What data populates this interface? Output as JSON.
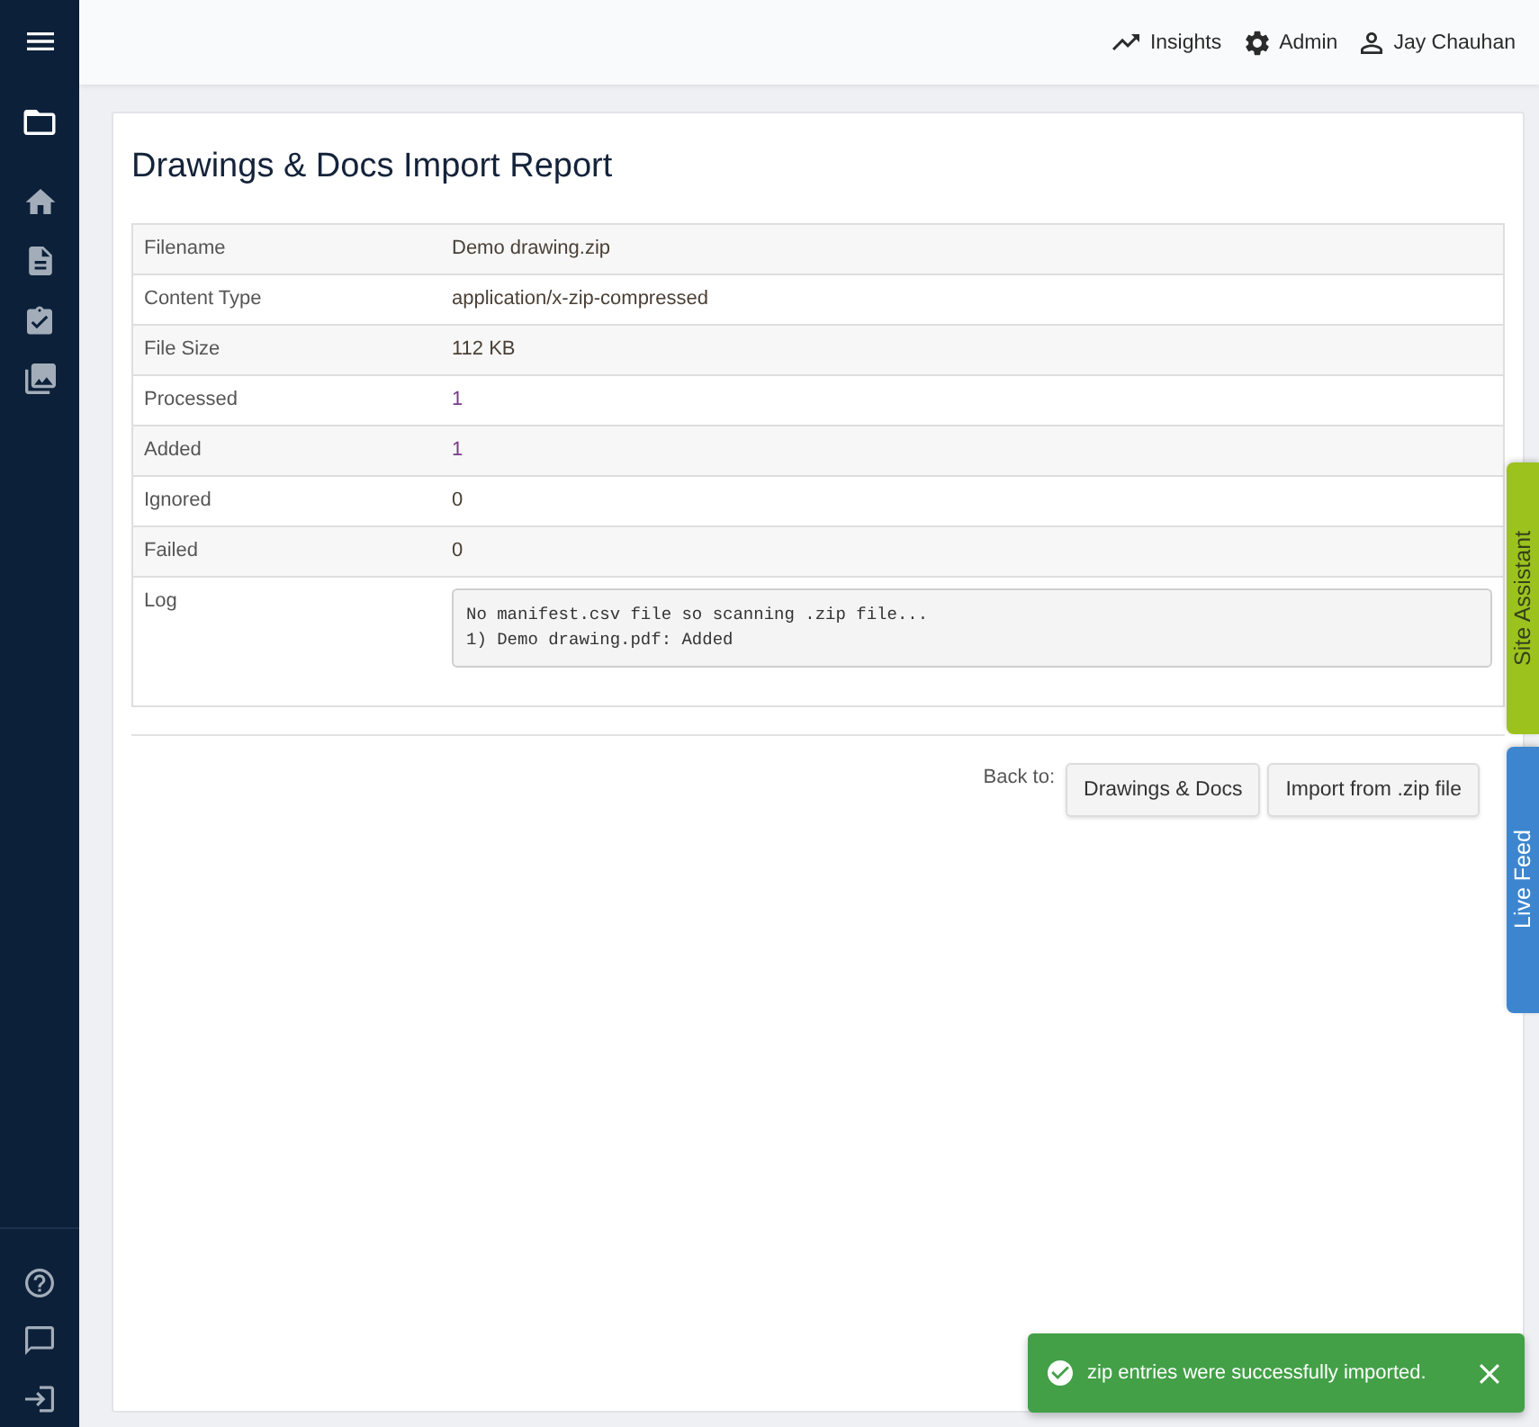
{
  "sidebar": {
    "items": [
      {
        "selected": true
      },
      {
        "selected": false
      },
      {
        "selected": false
      },
      {
        "selected": false
      },
      {
        "selected": false
      }
    ]
  },
  "top_bar": {
    "links": [
      {
        "label": "Insights"
      },
      {
        "label": "Admin"
      },
      {
        "label": "Jay Chauhan"
      }
    ]
  },
  "report": {
    "title": "Drawings & Docs Import Report",
    "rows": [
      {
        "kind": "text",
        "label": "Filename",
        "value": "Demo drawing.zip",
        "color": "#4a4036"
      },
      {
        "kind": "text",
        "label": "Content Type",
        "value": "application/x-zip-compressed",
        "color": "#4a4036"
      },
      {
        "kind": "text",
        "label": "File Size",
        "value": "112 KB",
        "color": "#4a4036"
      },
      {
        "kind": "text",
        "label": "Processed",
        "value": "1",
        "color": "#7a3a8c"
      },
      {
        "kind": "text",
        "label": "Added",
        "value": "1",
        "color": "#7a3a8c"
      },
      {
        "kind": "text",
        "label": "Ignored",
        "value": "0",
        "color": "#4a4036"
      },
      {
        "kind": "text",
        "label": "Failed",
        "value": "0",
        "color": "#4a4036"
      },
      {
        "kind": "log",
        "label": "Log",
        "lines": [
          "No manifest.csv file so scanning .zip file...",
          "1) Demo drawing.pdf: Added"
        ]
      }
    ]
  },
  "back_to": {
    "label": "Back to:",
    "buttons": [
      "Drawings & Docs",
      "Import from .zip file"
    ]
  },
  "side_tabs": [
    {
      "label": "Site Assistant",
      "color": "#9cc21e"
    },
    {
      "label": "Live Feed",
      "color": "#3d86cf"
    }
  ],
  "toast": {
    "message": "zip entries were successfully imported."
  }
}
